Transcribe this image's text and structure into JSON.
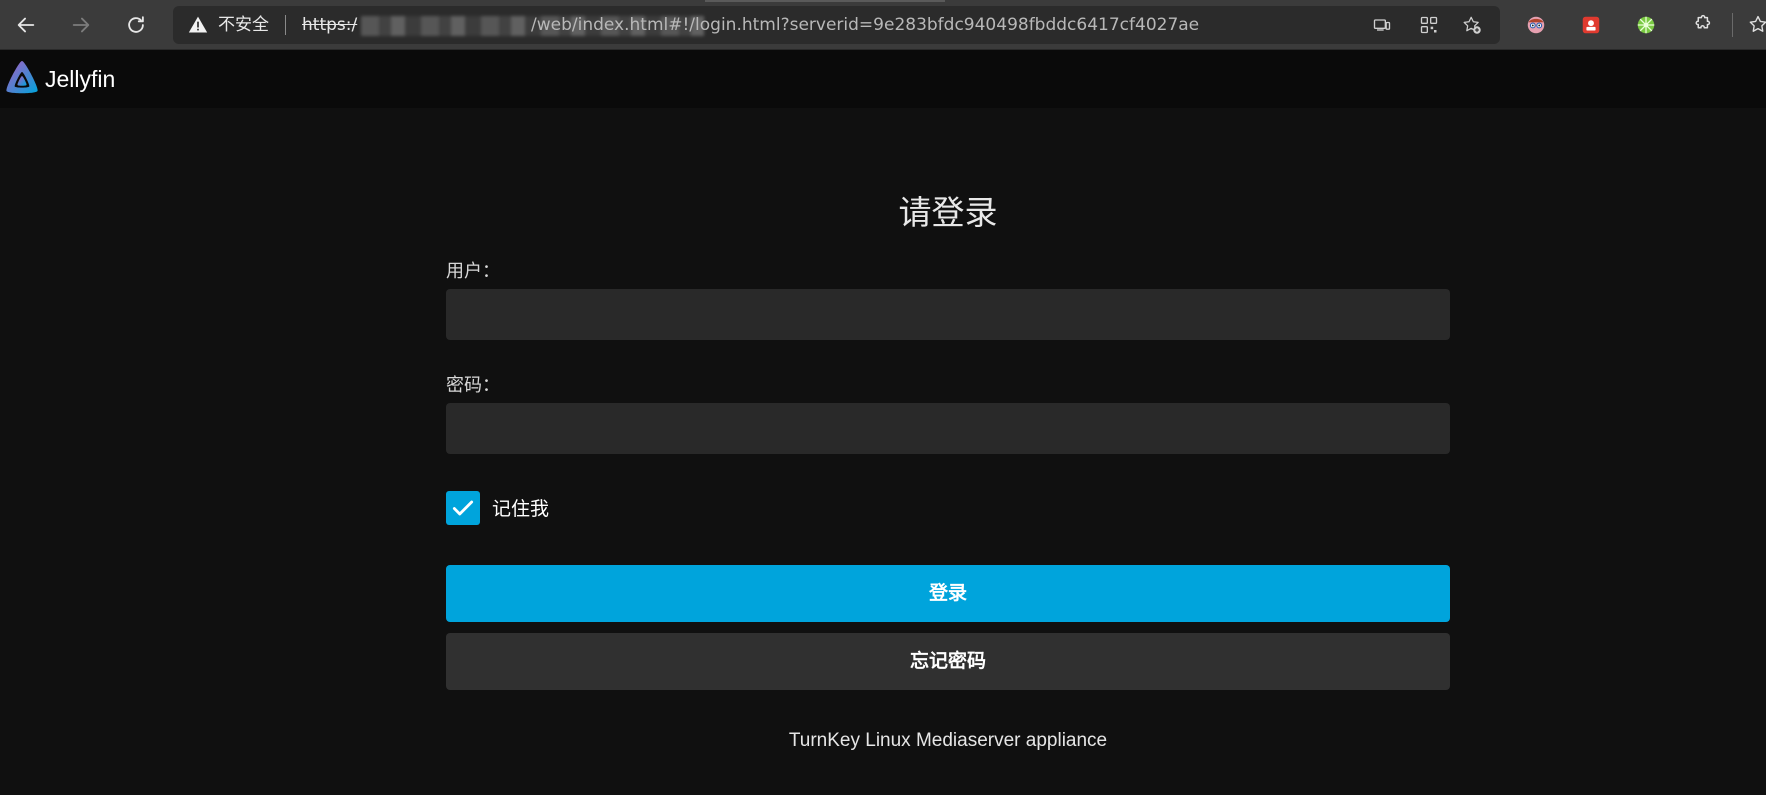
{
  "browser": {
    "security_label": "不安全",
    "url_scheme": "https:/",
    "url_path": "/web/index.html#!/login.html?serverid=9e283bfdc940498fbddc6417cf4027ae"
  },
  "app": {
    "name": "Jellyfin"
  },
  "login": {
    "title": "请登录",
    "username_label": "用户：",
    "username_value": "",
    "password_label": "密码：",
    "password_value": "",
    "remember_label": "记住我",
    "remember_checked": true,
    "login_button": "登录",
    "forgot_button": "忘记密码",
    "disclaimer": "TurnKey Linux Mediaserver appliance"
  },
  "colors": {
    "accent": "#00a4dc",
    "background": "#101010",
    "input_bg": "#292929",
    "secondary_button": "#303030"
  }
}
